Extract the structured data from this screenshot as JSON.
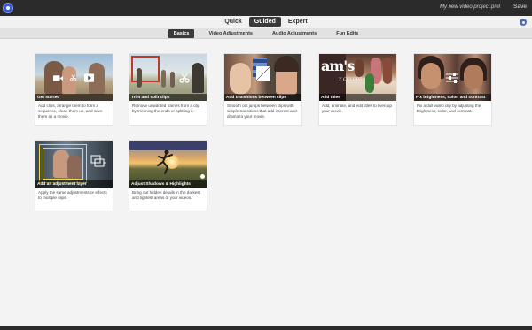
{
  "titlebar": {
    "project_name": "My new video project.prel",
    "save_label": "Save"
  },
  "mode_tabs": [
    "Quick",
    "Guided",
    "Expert"
  ],
  "sub_tabs": [
    "Basics",
    "Video Adjustments",
    "Audio Adjustments",
    "Fun Edits"
  ],
  "cards": [
    {
      "title": "Get started",
      "desc": "Add clips, arrange them to form a sequence, clean them up, and save them as a movie."
    },
    {
      "title": "Trim and split clips",
      "desc": "Remove unwanted frames from a clip by trimming the ends or splitting it."
    },
    {
      "title": "Add transitions between clips",
      "desc": "Smooth out jumps between clips with simple transitions that add interest and drama to your movie."
    },
    {
      "title": "Add titles",
      "desc": "Add, animate, and edit titles to liven up your movie."
    },
    {
      "title": "Fix brightness, color, and contrast",
      "desc": "Fix a dull video clip by adjusting the brightness, color, and contrast."
    },
    {
      "title": "Add an adjustment layer",
      "desc": "Apply the same adjustments or effects to multiple clips."
    },
    {
      "title": "Adjust Shadows & Highlights",
      "desc": "Bring out hidden details in the darkest and lightest areas of your videos."
    }
  ],
  "colors": {
    "active_tab": "#3a3a3a",
    "titlebar": "#2b2b2b",
    "background": "#f3f3f3"
  }
}
